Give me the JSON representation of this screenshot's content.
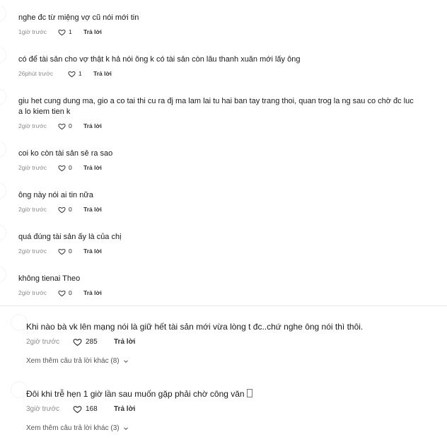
{
  "replies": [
    {
      "text": "nghe đc từ miệng vợ cũ nói mới tin",
      "time": "1giờ trước",
      "likes": "1",
      "reply": "Trả lời"
    },
    {
      "text": "có để tài sản cho vợ thật k hả nói ông k có tài sản còn lâu thanh xuân mới lấy ông",
      "time": "26phút trước",
      "likes": "1",
      "reply": "Trả lời"
    },
    {
      "text": "giu het cung dung ma, gio a co tai thi cu ra đj ma lam lai tu hai ban tay trang thoi, quan trog la ng sau co chờ đc luc a lo kiem tien k",
      "time": "2giờ trước",
      "likes": "0",
      "reply": "Trả lời"
    },
    {
      "text": "coi ko còn tài sản sẻ ra sao",
      "time": "2giờ trước",
      "likes": "0",
      "reply": "Trả lời"
    },
    {
      "text": "ông này nói ai tin nữa",
      "time": "2giờ trước",
      "likes": "0",
      "reply": "Trả lời"
    },
    {
      "text": "quá đúng tài sản ấy là của chị",
      "time": "2giờ trước",
      "likes": "0",
      "reply": "Trả lời"
    },
    {
      "text": "không tienai Theo",
      "time": "2giờ trước",
      "likes": "0",
      "reply": "Trả lời"
    }
  ],
  "comments": [
    {
      "text": "Khi nào bà vk lên mạng nói là giữ hết tài sản mới vừa lòng t đc..chứ nghe ông nói thì thôi.",
      "time": "2giờ trước",
      "likes": "285",
      "reply": "Trả lời",
      "more": "Xem thêm câu trả lời khác (8)"
    },
    {
      "text": "Đôi khi trễ hẹn 1 giờ lần sau muốn gặp phải chờ công văn",
      "time": "3giờ trước",
      "likes": "168",
      "reply": "Trả lời",
      "more": "Xem thêm câu trả lời khác (3)"
    }
  ],
  "icons": {
    "like": "heart-outline-icon",
    "expand": "chevron-down-icon"
  }
}
